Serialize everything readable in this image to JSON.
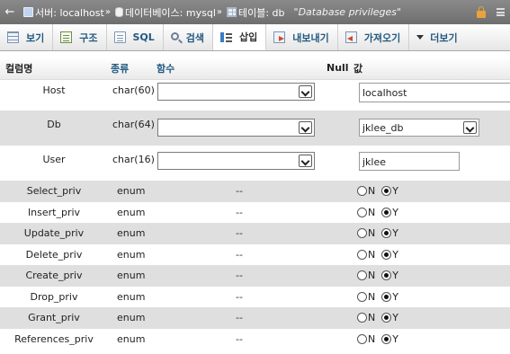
{
  "breadcrumb": {
    "back_glyph": "←",
    "server": "서버: localhost",
    "database": "데이터베이스: mysql",
    "table": "테이블: db",
    "separator": "»",
    "comment": "\"Database privileges\""
  },
  "tabs": [
    {
      "label": "보기",
      "icon": "browse-icon",
      "active": false
    },
    {
      "label": "구조",
      "icon": "structure-icon",
      "active": false
    },
    {
      "label": "SQL",
      "icon": "sql-icon",
      "active": false
    },
    {
      "label": "검색",
      "icon": "search-icon",
      "active": false
    },
    {
      "label": "삽입",
      "icon": "insert-icon",
      "active": true
    },
    {
      "label": "내보내기",
      "icon": "export-icon",
      "active": false
    },
    {
      "label": "가져오기",
      "icon": "import-icon",
      "active": false
    },
    {
      "label": "더보기",
      "icon": "chevron-down-icon",
      "active": false
    }
  ],
  "table_headers": {
    "column": "컬럼명",
    "type": "종류",
    "function": "함수",
    "null": "Null",
    "value": "값"
  },
  "text_rows": [
    {
      "column": "Host",
      "type": "char(60)",
      "value": "localhost",
      "value_kind": "input"
    },
    {
      "column": "Db",
      "type": "char(64)",
      "value": "jklee_db",
      "value_kind": "select"
    },
    {
      "column": "User",
      "type": "char(16)",
      "value": "jklee",
      "value_kind": "short-input"
    }
  ],
  "enum_rows": [
    {
      "column": "Select_priv",
      "type": "enum",
      "function": "--",
      "selected": "Y"
    },
    {
      "column": "Insert_priv",
      "type": "enum",
      "function": "--",
      "selected": "Y"
    },
    {
      "column": "Update_priv",
      "type": "enum",
      "function": "--",
      "selected": "Y"
    },
    {
      "column": "Delete_priv",
      "type": "enum",
      "function": "--",
      "selected": "Y"
    },
    {
      "column": "Create_priv",
      "type": "enum",
      "function": "--",
      "selected": "Y"
    },
    {
      "column": "Drop_priv",
      "type": "enum",
      "function": "--",
      "selected": "Y"
    },
    {
      "column": "Grant_priv",
      "type": "enum",
      "function": "--",
      "selected": "Y"
    },
    {
      "column": "References_priv",
      "type": "enum",
      "function": "--",
      "selected": "Y"
    }
  ],
  "radio_labels": {
    "n": "N",
    "y": "Y"
  }
}
